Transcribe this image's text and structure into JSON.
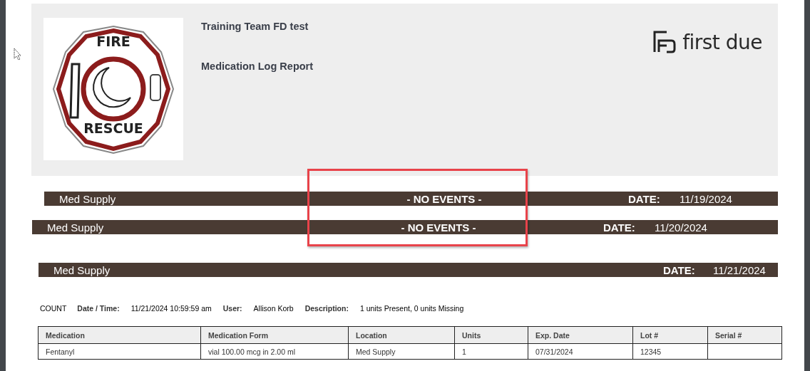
{
  "header": {
    "logo": {
      "top_text": "FIRE",
      "bottom_text": "RESCUE"
    },
    "organization": "Training Team FD test",
    "report_title": "Medication Log Report",
    "brand": "first due"
  },
  "supply_bars": [
    {
      "location": "Med Supply",
      "status": "- NO EVENTS -",
      "date_label": "DATE:",
      "date": "11/19/2024"
    },
    {
      "location": "Med Supply",
      "status": "- NO EVENTS -",
      "date_label": "DATE:",
      "date": "11/20/2024"
    },
    {
      "location": "Med Supply",
      "date_label": "DATE:",
      "date": "11/21/2024"
    }
  ],
  "event": {
    "type": "COUNT",
    "datetime_label": "Date / Time:",
    "datetime": "11/21/2024 10:59:59 am",
    "user_label": "User:",
    "user": "Allison Korb",
    "description_label": "Description:",
    "description": "1 units Present, 0 units Missing"
  },
  "table": {
    "columns": [
      "Medication",
      "Medication Form",
      "Location",
      "Units",
      "Exp. Date",
      "Lot #",
      "Serial #"
    ],
    "rows": [
      [
        "Fentanyl",
        "vial 100.00 mcg in 2.00 ml",
        "Med Supply",
        "1",
        "07/31/2024",
        "12345",
        ""
      ]
    ]
  }
}
